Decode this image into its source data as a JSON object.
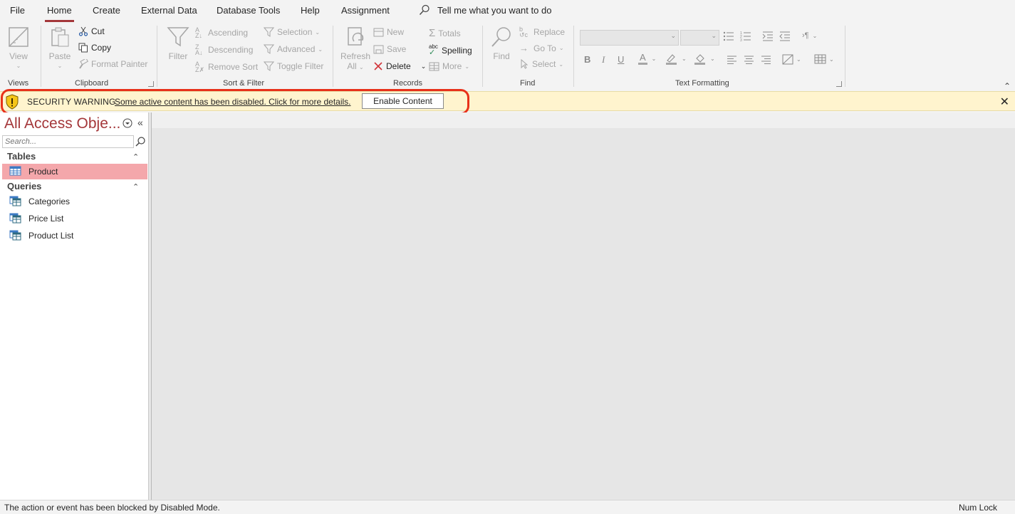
{
  "tabs": [
    {
      "label": "File"
    },
    {
      "label": "Home",
      "active": true
    },
    {
      "label": "Create"
    },
    {
      "label": "External Data"
    },
    {
      "label": "Database Tools"
    },
    {
      "label": "Help"
    },
    {
      "label": "Assignment"
    }
  ],
  "tell_me": "Tell me what you want to do",
  "ribbon": {
    "views": {
      "label": "Views",
      "view": "View"
    },
    "clipboard": {
      "label": "Clipboard",
      "paste": "Paste",
      "cut": "Cut",
      "copy": "Copy",
      "format_painter": "Format Painter"
    },
    "sort_filter": {
      "label": "Sort & Filter",
      "filter": "Filter",
      "ascending": "Ascending",
      "descending": "Descending",
      "remove_sort": "Remove Sort",
      "selection": "Selection",
      "advanced": "Advanced",
      "toggle_filter": "Toggle Filter"
    },
    "records": {
      "label": "Records",
      "refresh": "Refresh",
      "refresh_all": "All",
      "new": "New",
      "save": "Save",
      "delete": "Delete",
      "totals": "Totals",
      "spelling": "Spelling",
      "more": "More"
    },
    "find": {
      "label": "Find",
      "find": "Find",
      "replace": "Replace",
      "goto": "Go To",
      "select": "Select"
    },
    "text_formatting": {
      "label": "Text Formatting",
      "bold": "B",
      "italic": "I",
      "underline": "U"
    }
  },
  "security": {
    "title": "SECURITY WARNING",
    "message": "Some active content has been disabled. Click for more details.",
    "button": "Enable Content"
  },
  "nav": {
    "title": "All Access Obje...",
    "search_placeholder": "Search...",
    "groups": [
      {
        "label": "Tables",
        "items": [
          {
            "label": "Product",
            "selected": true
          }
        ]
      },
      {
        "label": "Queries",
        "items": [
          {
            "label": "Categories"
          },
          {
            "label": "Price List"
          },
          {
            "label": "Product List"
          }
        ]
      }
    ]
  },
  "status": {
    "message": "The action or event has been blocked by Disabled Mode.",
    "num_lock": "Num Lock"
  },
  "colors": {
    "accent": "#a4373a",
    "security_bar": "#fff4ce",
    "highlight_outline": "#e8311a",
    "selected_item": "#f4a7ab"
  }
}
